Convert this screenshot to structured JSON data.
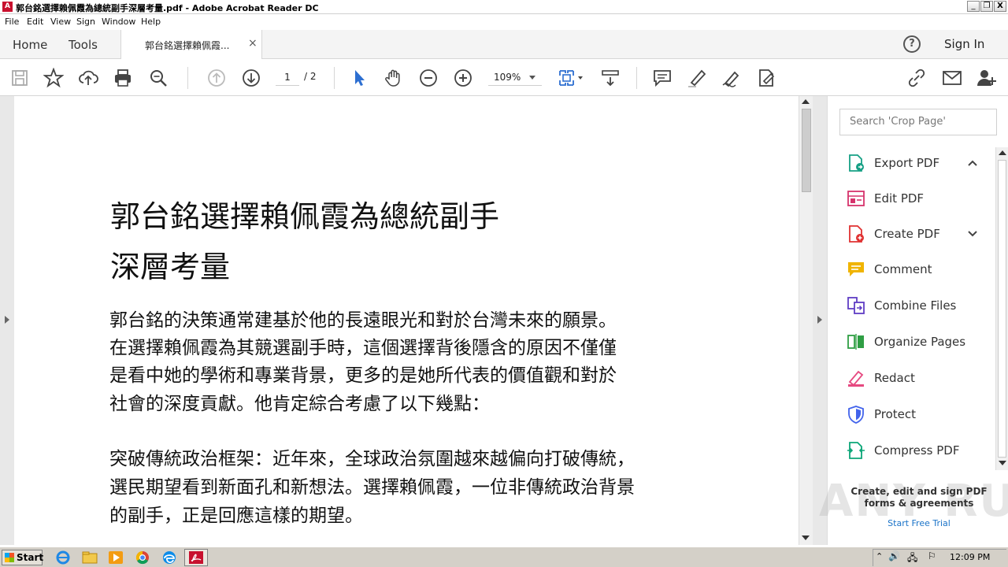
{
  "window": {
    "title": "郭台銘選擇賴佩霞為總統副手深層考量.pdf - Adobe Acrobat Reader DC",
    "controls": [
      "_",
      "❐",
      "X"
    ]
  },
  "menu": [
    "File",
    "Edit",
    "View",
    "Sign",
    "Window",
    "Help"
  ],
  "tabs": {
    "home": "Home",
    "tools": "Tools",
    "document": "郭台銘選擇賴佩霞...",
    "close": "×",
    "sign_in": "Sign In"
  },
  "toolbar": {
    "page_current": "1",
    "page_total": "/ 2",
    "zoom": "109%"
  },
  "document": {
    "title_lines": [
      "郭台銘選擇賴佩霞為總統副手",
      "深層考量"
    ],
    "paragraph1": [
      "郭台銘的決策通常建基於他的長遠眼光和對於台灣未來的願景。",
      "在選擇賴佩霞為其競選副手時，這個選擇背後隱含的原因不僅僅",
      "是看中她的學術和專業背景，更多的是她所代表的價值觀和對於",
      "社會的深度貢獻。他肯定綜合考慮了以下幾點："
    ],
    "paragraph2": [
      "突破傳統政治框架：近年來，全球政治氛圍越來越偏向打破傳統，",
      "選民期望看到新面孔和新想法。選擇賴佩霞，一位非傳統政治背景",
      "的副手，正是回應這樣的期望。"
    ]
  },
  "right_pane": {
    "search_placeholder": "Search 'Crop Page'",
    "tools": [
      {
        "label": "Export PDF",
        "icon": "export-pdf-icon",
        "color": "#16a085"
      },
      {
        "label": "Edit PDF",
        "icon": "edit-pdf-icon",
        "color": "#d6336c"
      },
      {
        "label": "Create PDF",
        "icon": "create-pdf-icon",
        "color": "#e03131"
      },
      {
        "label": "Comment",
        "icon": "comment-icon",
        "color": "#f0b400"
      },
      {
        "label": "Combine Files",
        "icon": "combine-files-icon",
        "color": "#5f3dc4"
      },
      {
        "label": "Organize Pages",
        "icon": "organize-pages-icon",
        "color": "#2f9e44"
      },
      {
        "label": "Redact",
        "icon": "redact-icon",
        "color": "#e64980"
      },
      {
        "label": "Protect",
        "icon": "protect-icon",
        "color": "#4263eb"
      },
      {
        "label": "Compress PDF",
        "icon": "compress-pdf-icon",
        "color": "#0ca678"
      }
    ],
    "promo_line1": "Create, edit and sign PDF",
    "promo_line2": "forms & agreements",
    "promo_link": "Start Free Trial",
    "watermark": "ANY RUN"
  },
  "taskbar": {
    "start": "Start",
    "clock": "12:09 PM"
  }
}
